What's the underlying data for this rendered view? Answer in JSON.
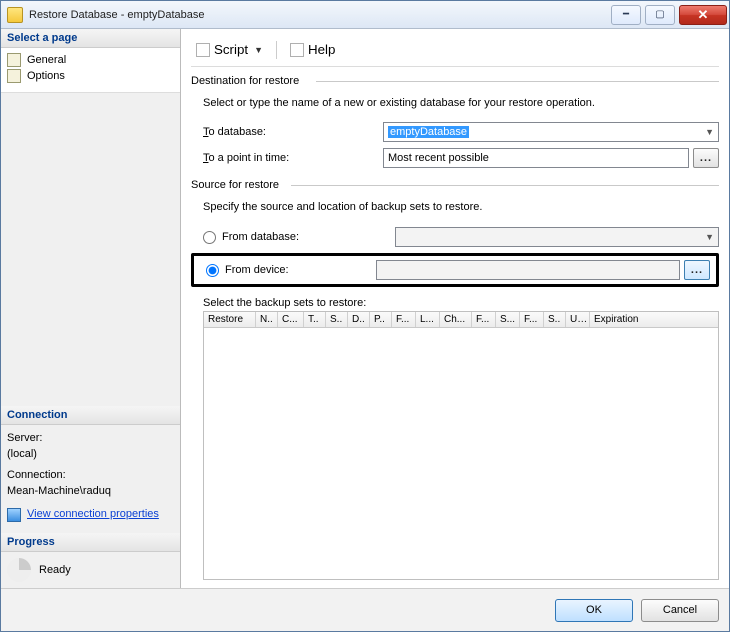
{
  "titlebar": {
    "title": "Restore Database - emptyDatabase"
  },
  "sidebar": {
    "select_page": "Select a page",
    "items": [
      "General",
      "Options"
    ],
    "connection": {
      "header": "Connection",
      "server_label": "Server:",
      "server_value": "(local)",
      "conn_label": "Connection:",
      "conn_value": "Mean-Machine\\raduq",
      "link": "View connection properties"
    },
    "progress": {
      "header": "Progress",
      "state": "Ready"
    }
  },
  "toolbar": {
    "script": "Script",
    "help": "Help"
  },
  "dest": {
    "legend": "Destination for restore",
    "hint": "Select or type the name of a new or existing database for your restore operation.",
    "to_db": "o database:",
    "to_db_value": "emptyDatabase",
    "to_pit": "o a point in time:",
    "to_pit_value": "Most recent possible"
  },
  "source": {
    "legend": "Source for restore",
    "hint": "Specify the source and location of backup sets to restore.",
    "from_db": "From database:",
    "from_dev": "From device:",
    "grid_label": "elect the backup sets to restore:",
    "columns": [
      "Restore",
      "N..",
      "C...",
      "T..",
      "S..",
      "D..",
      "P..",
      "F...",
      "L...",
      "Ch...",
      "F...",
      "S...",
      "F...",
      "S..",
      "U...",
      "Expiration"
    ]
  },
  "buttons": {
    "ok": "OK",
    "cancel": "Cancel"
  }
}
